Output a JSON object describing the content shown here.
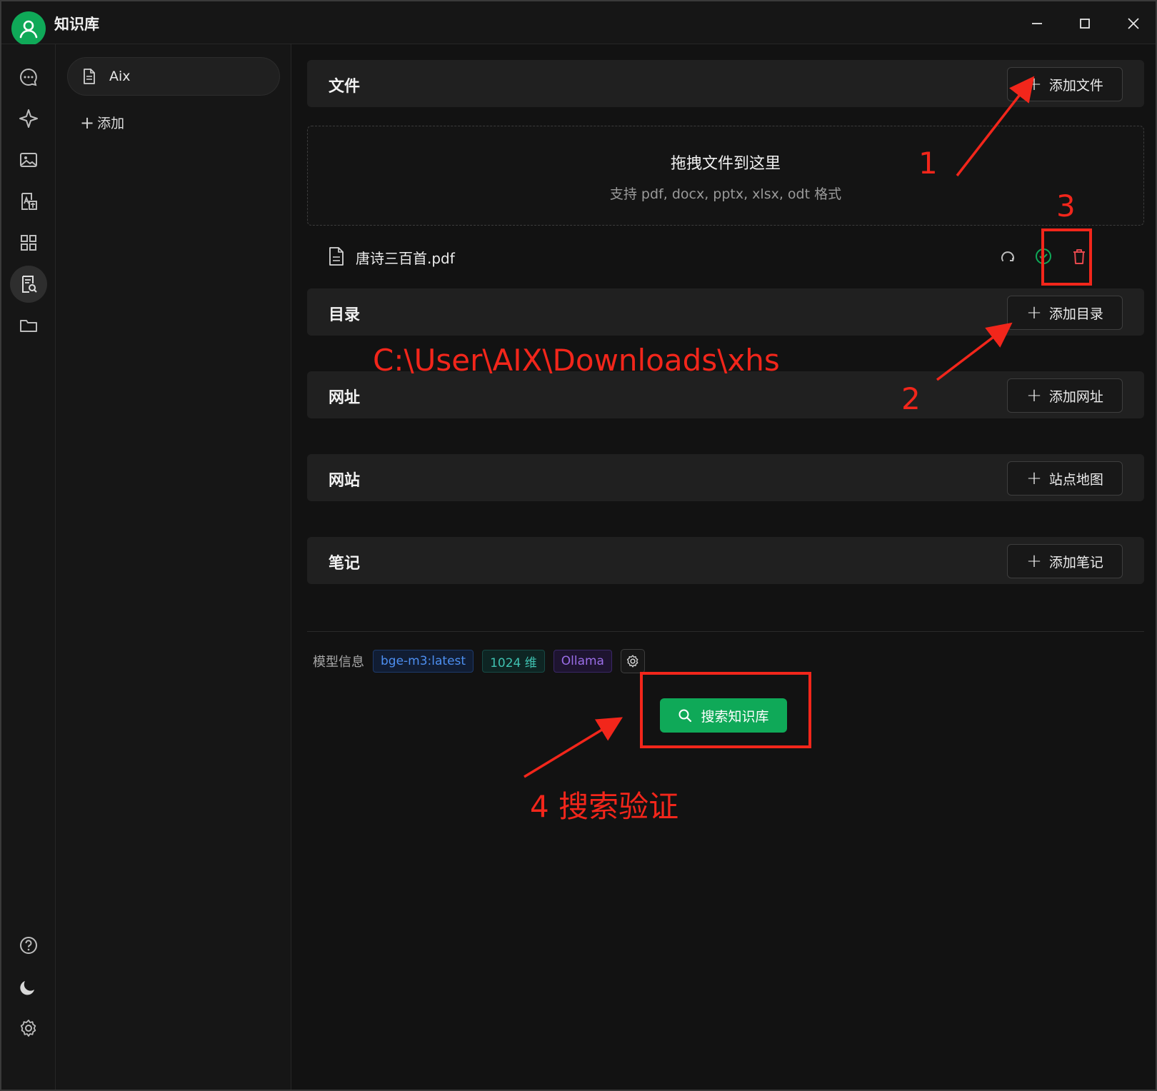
{
  "app": {
    "title": "知识库"
  },
  "window_controls": {
    "minimize": "minimize-icon",
    "maximize": "maximize-icon",
    "close": "close-icon"
  },
  "rail": {
    "items": [
      {
        "icon": "chat-icon"
      },
      {
        "icon": "sparkle-icon"
      },
      {
        "icon": "image-icon"
      },
      {
        "icon": "translate-icon"
      },
      {
        "icon": "apps-grid-icon"
      },
      {
        "icon": "knowledge-base-icon",
        "active": true
      },
      {
        "icon": "folder-icon"
      }
    ],
    "bottom": [
      {
        "icon": "help-icon"
      },
      {
        "icon": "moon-icon"
      },
      {
        "icon": "settings-icon"
      }
    ]
  },
  "sidebar": {
    "items": [
      {
        "label": "Aix"
      }
    ],
    "add_label": "添加"
  },
  "main": {
    "files": {
      "title": "文件",
      "button": "添加文件"
    },
    "dropzone": {
      "title": "拖拽文件到这里",
      "hint": "支持 pdf, docx, pptx, xlsx, odt 格式"
    },
    "file_list": [
      {
        "name": "唐诗三百首.pdf"
      }
    ],
    "directories": {
      "title": "目录",
      "button": "添加目录"
    },
    "urls": {
      "title": "网址",
      "button": "添加网址"
    },
    "websites": {
      "title": "网站",
      "button": "站点地图"
    },
    "notes": {
      "title": "笔记",
      "button": "添加笔记"
    },
    "model_info": {
      "label": "模型信息",
      "model": "bge-m3:latest",
      "dimensions": "1024 维",
      "provider": "Ollama"
    },
    "search_button": "搜索知识库"
  },
  "annotations": {
    "n1": "1",
    "n2": "2",
    "n3": "3",
    "path": "C:\\User\\AIX\\Downloads\\xhs",
    "n4": "4 搜索验证"
  },
  "colors": {
    "accent": "#0fa958",
    "annotation": "#f2261b",
    "delete": "#e5484d"
  }
}
